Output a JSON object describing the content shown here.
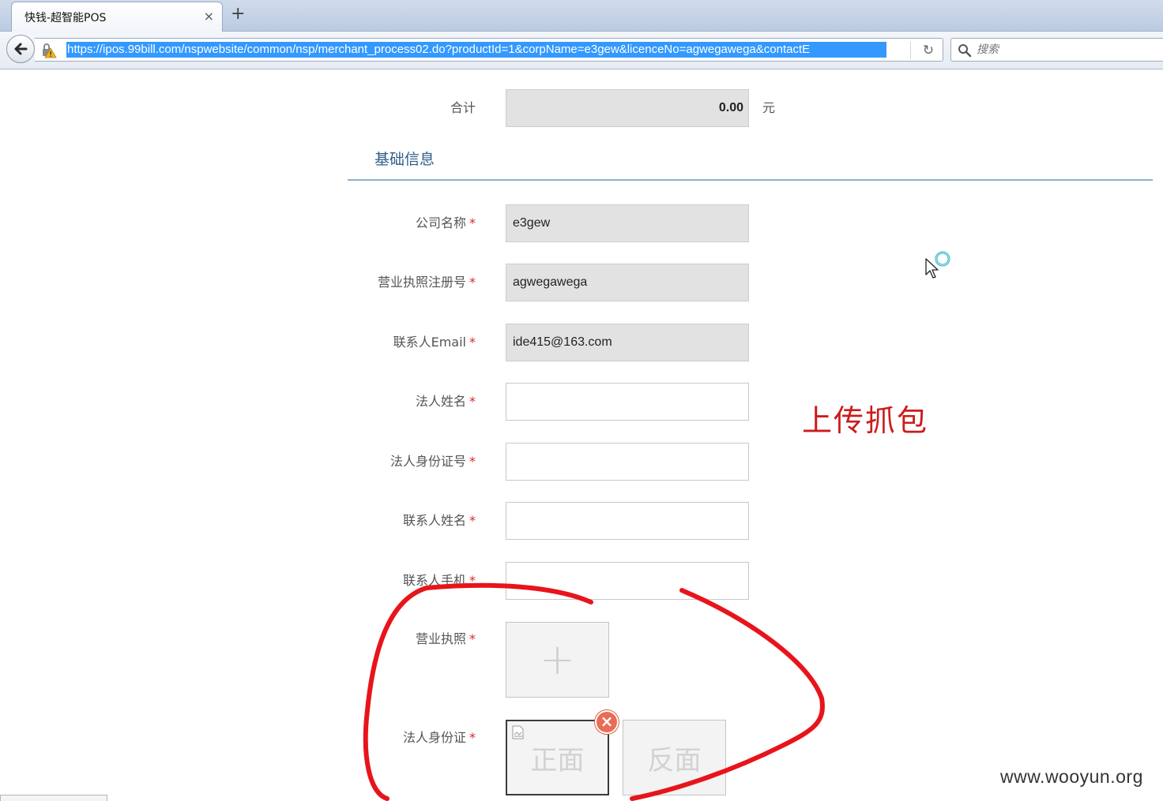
{
  "browser": {
    "tab_title": "快钱-超智能POS",
    "tab_close": "×",
    "new_tab": "+",
    "url": "https://ipos.99bill.com/nspwebsite/common/nsp/merchant_process02.do?productId=1&corpName=e3gew&licenceNo=agwegawega&contactE",
    "search_placeholder": "搜索"
  },
  "form": {
    "total": {
      "label": "合计",
      "value": "0.00",
      "unit": "元"
    },
    "section_title": "基础信息",
    "fields": [
      {
        "label": "公司名称",
        "required": "*",
        "value": "e3gew"
      },
      {
        "label": "营业执照注册号",
        "required": "*",
        "value": "agwegawega"
      },
      {
        "label": "联系人Email",
        "required": "*",
        "value": "ide415@163.com"
      },
      {
        "label": "法人姓名",
        "required": "*",
        "value": ""
      },
      {
        "label": "法人身份证号",
        "required": "*",
        "value": ""
      },
      {
        "label": "联系人姓名",
        "required": "*",
        "value": ""
      },
      {
        "label": "联系人手机",
        "required": "*",
        "value": ""
      }
    ],
    "license_upload": {
      "label": "营业执照",
      "required": "*",
      "plus": "+"
    },
    "id_upload": {
      "label": "法人身份证",
      "required": "*",
      "front": "正面",
      "back": "反面",
      "remove": "×"
    }
  },
  "annotation": {
    "text": "上传抓包",
    "color": "#cc1b1b"
  },
  "watermark": "www.wooyun.org",
  "colors": {
    "section_title": "#2f5e88",
    "required": "#d8262e",
    "readonly_bg": "#e2e2e2",
    "selection": "#3399ff"
  },
  "icons": [
    "back-arrow-icon",
    "lock-warning-icon",
    "reload-icon",
    "search-icon",
    "plus-icon",
    "broken-image-icon",
    "remove-icon",
    "cursor-busy-icon"
  ]
}
